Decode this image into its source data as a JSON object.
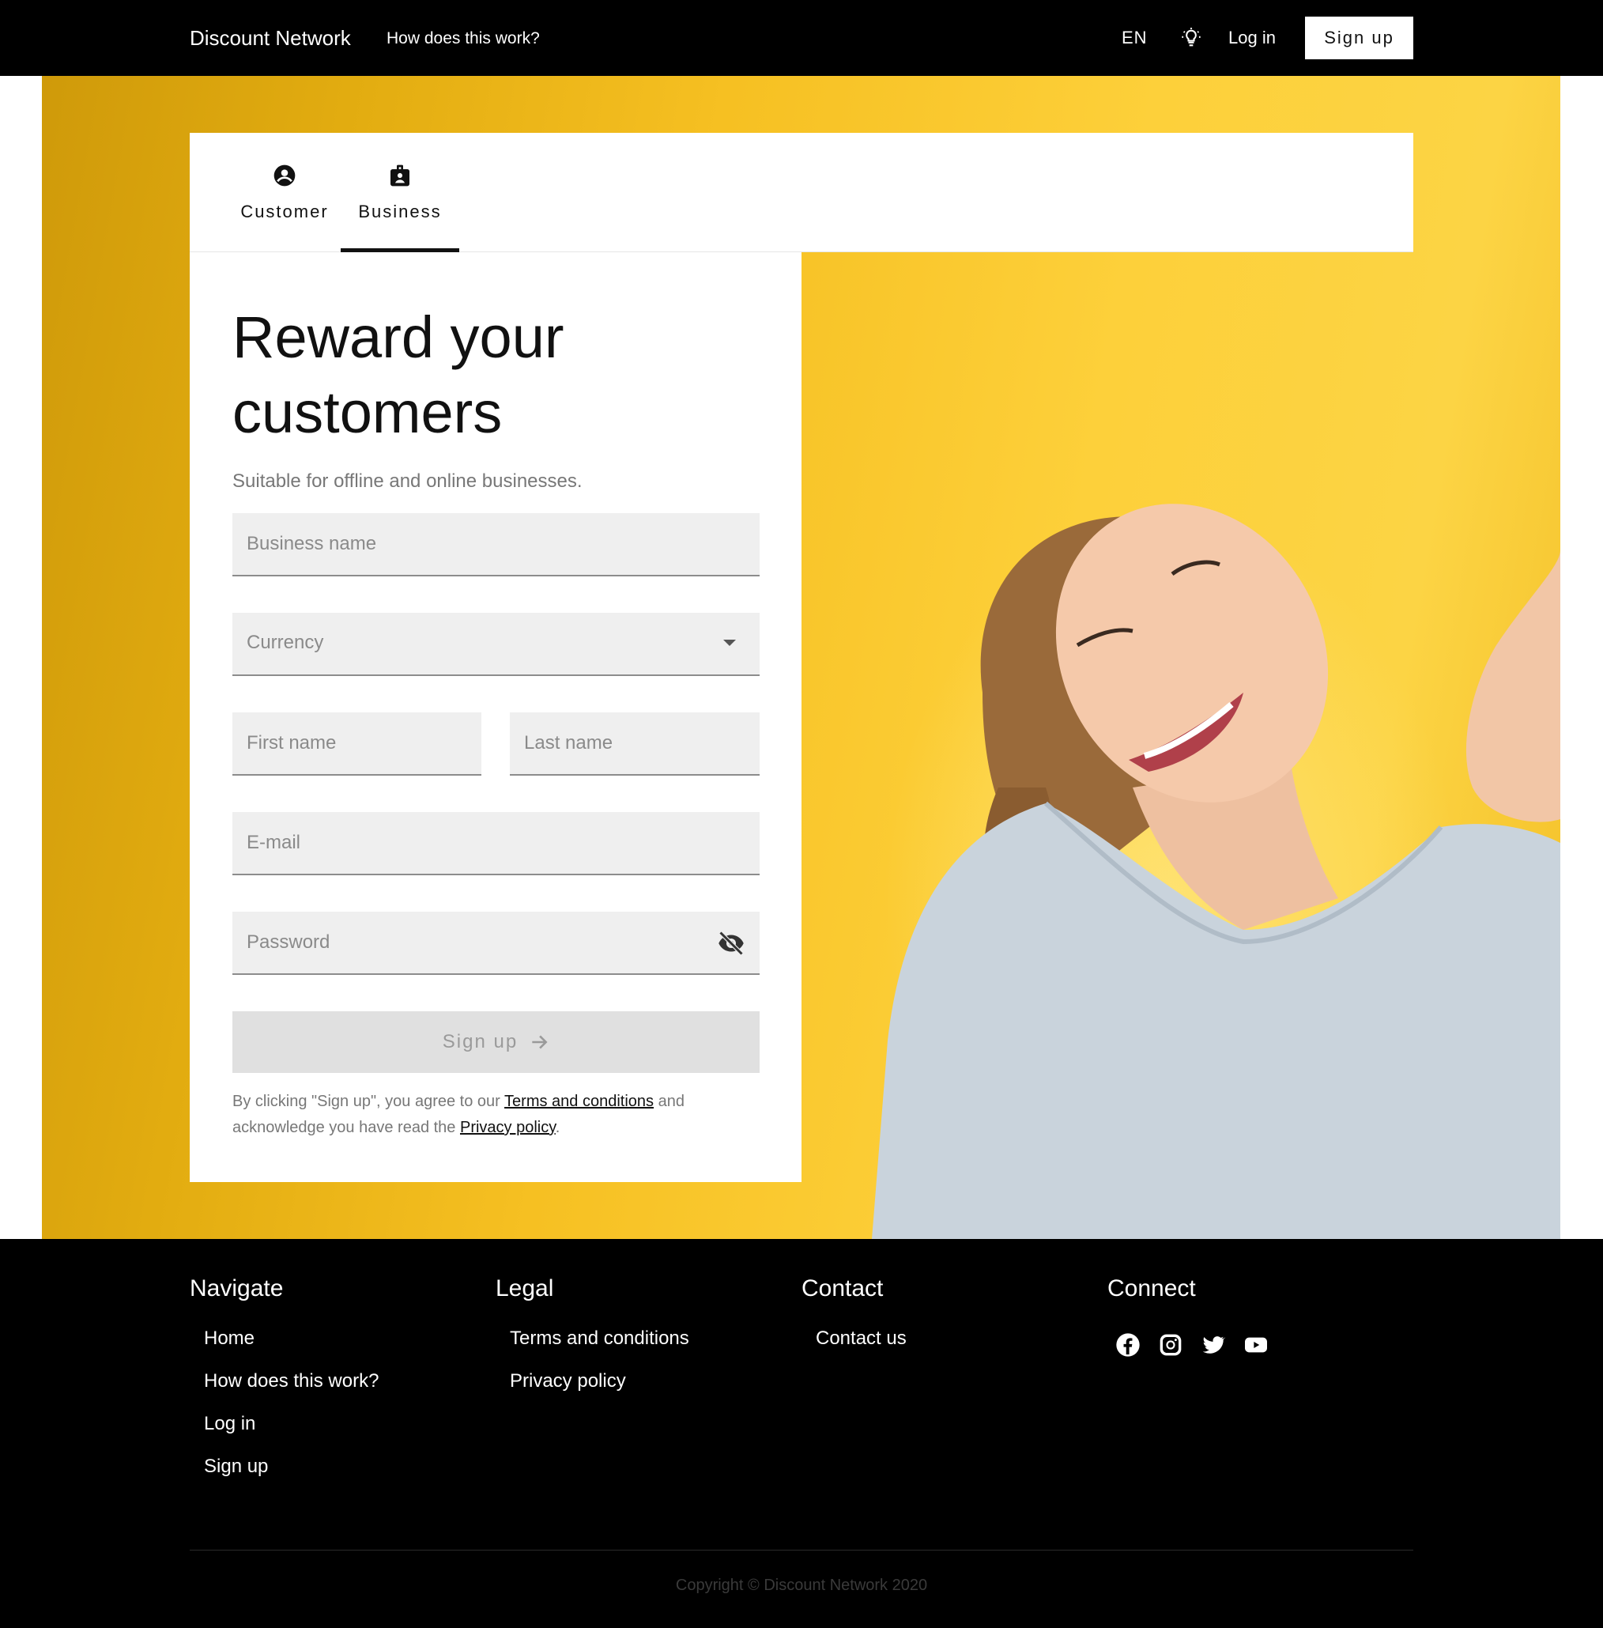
{
  "header": {
    "brand": "Discount Network",
    "nav_how": "How does this work?",
    "language": "EN",
    "theme_icon": "lightbulb-icon",
    "login": "Log in",
    "signup": "Sign up"
  },
  "tabs": [
    {
      "label": "Customer",
      "icon": "account-circle-icon",
      "active": false
    },
    {
      "label": "Business",
      "icon": "badge-icon",
      "active": true
    }
  ],
  "form": {
    "title": "Reward your customers",
    "subtitle": "Suitable for offline and online businesses.",
    "business_name_placeholder": "Business name",
    "currency_label": "Currency",
    "first_name_placeholder": "First name",
    "last_name_placeholder": "Last name",
    "email_placeholder": "E-mail",
    "password_placeholder": "Password",
    "submit_label": "Sign up",
    "legal_prefix": "By clicking \"Sign up\", you agree to our ",
    "terms_link": "Terms and conditions",
    "legal_middle": " and acknowledge you have read the ",
    "privacy_link": "Privacy policy",
    "legal_suffix": "."
  },
  "colors": {
    "accent_yellow": "#f6c022",
    "header_bg": "#000000",
    "field_bg": "#efefef"
  },
  "footer": {
    "navigate": {
      "title": "Navigate",
      "items": [
        "Home",
        "How does this work?",
        "Log in",
        "Sign up"
      ]
    },
    "legal": {
      "title": "Legal",
      "items": [
        "Terms and conditions",
        "Privacy policy"
      ]
    },
    "contact": {
      "title": "Contact",
      "items": [
        "Contact us"
      ]
    },
    "connect": {
      "title": "Connect",
      "icons": [
        "facebook-icon",
        "instagram-icon",
        "twitter-icon",
        "youtube-icon"
      ]
    },
    "copyright": "Copyright © Discount Network 2020"
  }
}
